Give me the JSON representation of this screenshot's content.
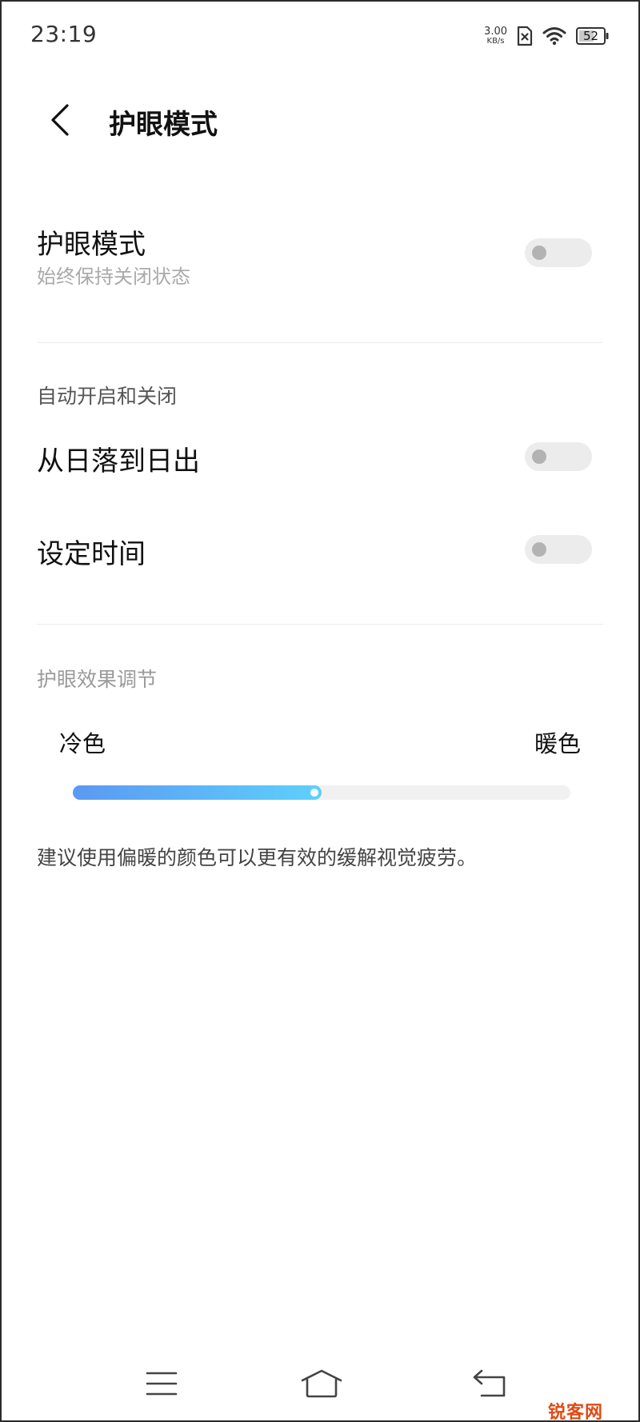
{
  "status_bar": {
    "time": "23:19",
    "net_speed_value": "3.00",
    "net_speed_unit": "KB/s",
    "battery_level": "52"
  },
  "header": {
    "title": "护眼模式"
  },
  "eye_care": {
    "title": "护眼模式",
    "subtitle": "始终保持关闭状态",
    "enabled": false
  },
  "auto_section": {
    "label": "自动开启和关闭",
    "items": [
      {
        "label": "从日落到日出",
        "enabled": false
      },
      {
        "label": "设定时间",
        "enabled": false
      }
    ]
  },
  "effect_section": {
    "label": "护眼效果调节",
    "cold_label": "冷色",
    "warm_label": "暖色",
    "level": 0.5
  },
  "hint": "建议使用偏暖的颜色可以更有效的缓解视觉疲劳。",
  "watermark": "锐客网",
  "colors": {
    "accent_start": "#5b99f2",
    "accent_end": "#5fd0fb",
    "toggle_off": "#ececec"
  }
}
